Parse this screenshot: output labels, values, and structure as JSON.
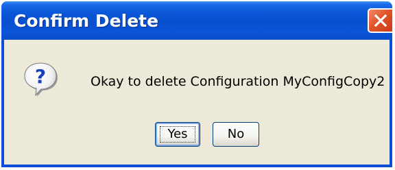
{
  "dialog": {
    "title": "Confirm Delete",
    "message": "Okay to delete Configuration MyConfigCopy2",
    "icon": "question-icon"
  },
  "buttons": {
    "yes_label": "Yes",
    "no_label": "No",
    "close_icon": "close-icon"
  },
  "colors": {
    "titlebar": "#0a57d8",
    "close_button": "#e2542b",
    "dialog_background": "#ece9d8",
    "button_border": "#003c74"
  }
}
